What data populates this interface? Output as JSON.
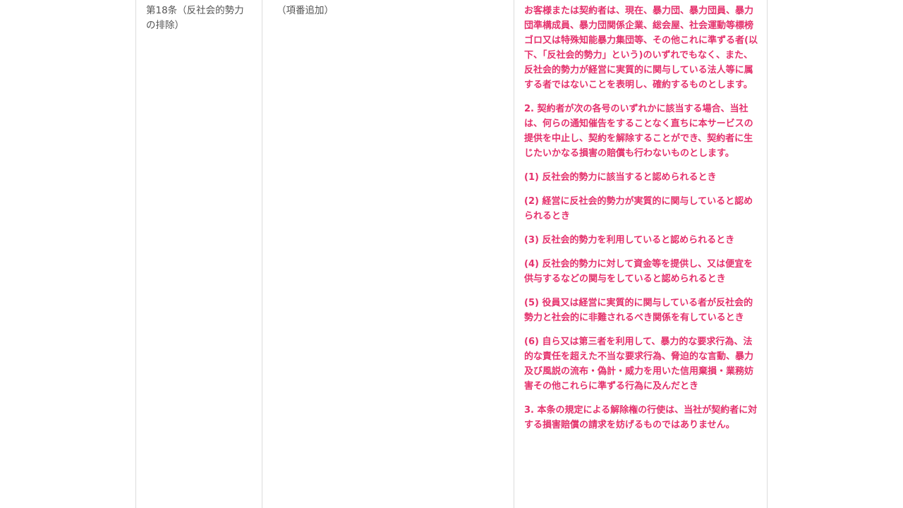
{
  "article": {
    "title": "第18条（反社会的勢力の排除）"
  },
  "old_text": "（項番追加）",
  "new_paragraphs": [
    "お客様または契約者は、現在、暴力団、暴力団員、暴力団準構成員、暴力団関係企業、総会屋、社会運動等標榜ゴロ又は特殊知能暴力集団等、その他これに準ずる者(以下、「反社会的勢力」という)のいずれでもなく、また、反社会的勢力が経営に実質的に関与している法人等に属する者ではないことを表明し、確約するものとします。",
    "2. 契約者が次の各号のいずれかに該当する場合、当社は、何らの通知催告をすることなく直ちに本サービスの提供を中止し、契約を解除することができ、契約者に生じたいかなる損害の賠償も行わないものとします。",
    "(1) 反社会的勢力に該当すると認められるとき",
    "(2) 経営に反社会的勢力が実質的に関与していると認められるとき",
    "(3) 反社会的勢力を利用していると認められるとき",
    "(4) 反社会的勢力に対して資金等を提供し、又は便宜を供与するなどの関与をしていると認められるとき",
    "(5) 役員又は経営に実質的に関与している者が反社会的勢力と社会的に非難されるべき関係を有しているとき",
    "(6) 自ら又は第三者を利用して、暴力的な要求行為、法的な責任を超えた不当な要求行為、脅迫的な言動、暴力及び風説の流布・偽計・威力を用いた信用棄損・業務妨害その他これらに準ずる行為に及んだとき",
    "3. 本条の規定による解除権の行使は、当社が契約者に対する損害賠償の請求を妨げるものではありません。"
  ],
  "colors": {
    "new_text": "#e5326d",
    "plain_text": "#555555",
    "border": "#dcdcdc"
  }
}
